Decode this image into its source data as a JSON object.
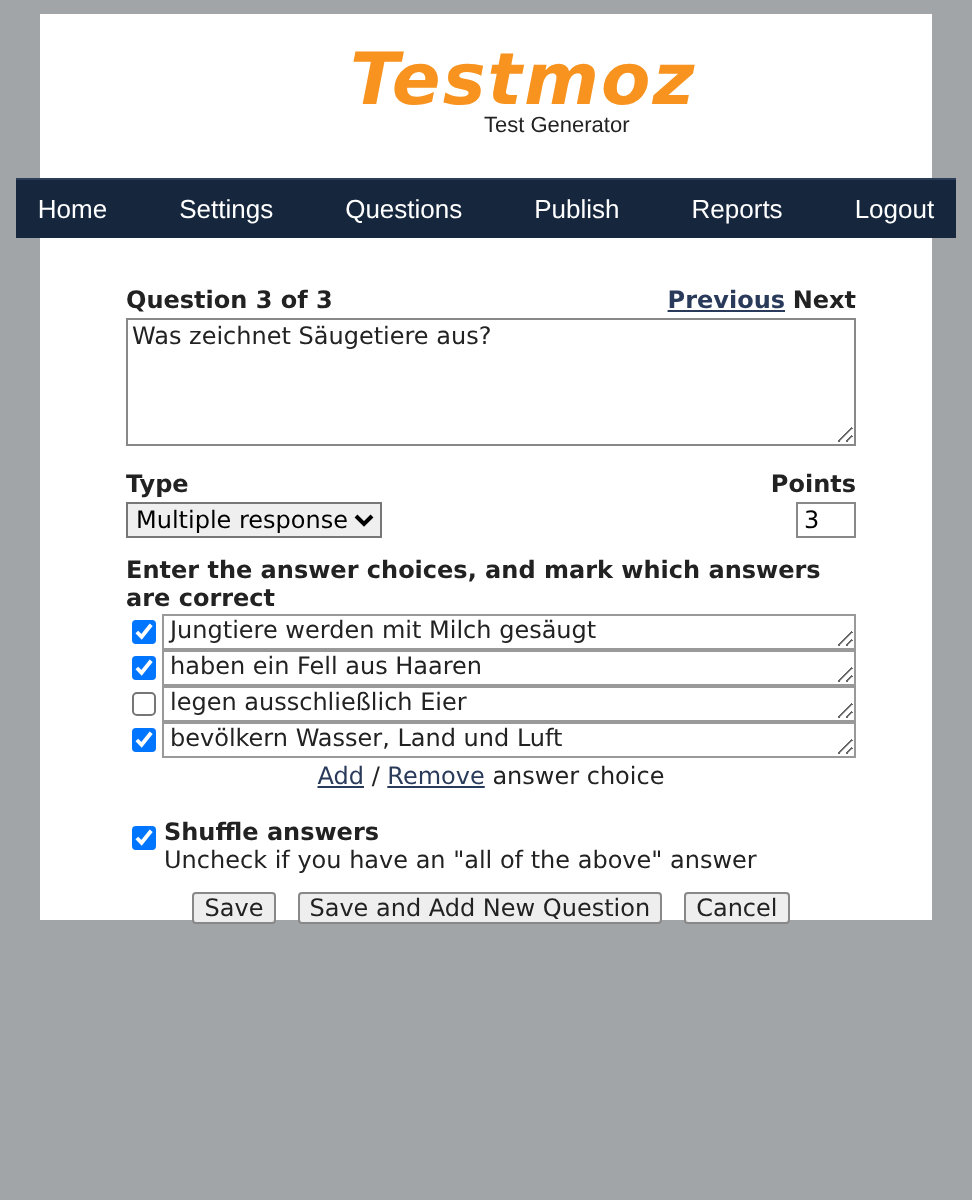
{
  "logo": {
    "title": "Testmoz",
    "subtitle": "Test Generator"
  },
  "nav": [
    {
      "label": "Home"
    },
    {
      "label": "Settings"
    },
    {
      "label": "Questions"
    },
    {
      "label": "Publish"
    },
    {
      "label": "Reports"
    },
    {
      "label": "Logout"
    }
  ],
  "question": {
    "heading": "Question 3 of 3",
    "previous": "Previous",
    "next": "Next",
    "text": "Was zeichnet Säugetiere aus?"
  },
  "type": {
    "label": "Type",
    "value": "Multiple response"
  },
  "points": {
    "label": "Points",
    "value": "3"
  },
  "answers": {
    "instruction": "Enter the answer choices, and mark which answers are correct",
    "choices": [
      {
        "text": "Jungtiere werden mit Milch gesäugt",
        "checked": true
      },
      {
        "text": "haben ein Fell aus Haaren",
        "checked": true
      },
      {
        "text": "legen ausschließlich Eier",
        "checked": false
      },
      {
        "text": "bevölkern Wasser, Land und Luft",
        "checked": true
      }
    ],
    "add": "Add",
    "separator": "/",
    "remove": "Remove",
    "suffix": "answer choice"
  },
  "shuffle": {
    "label": "Shuffle answers",
    "checked": true,
    "hint": "Uncheck if you have an \"all of the above\" answer"
  },
  "buttons": [
    "Save",
    "Save and Add New Question",
    "Cancel"
  ]
}
